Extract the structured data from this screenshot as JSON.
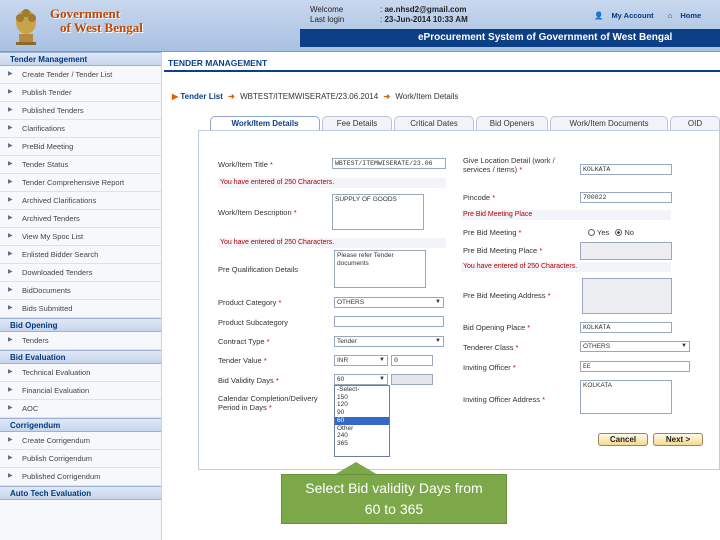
{
  "header": {
    "govt_title_line1": "Government",
    "govt_title_line2": "of West Bengal",
    "welcome_label": "Welcome",
    "welcome_value": "ae.nhsd2@gmail.com",
    "lastlogin_label": "Last login",
    "lastlogin_value": "23-Jun-2014 10:33 AM",
    "my_account": "My Account",
    "home": "Home",
    "system_title": "eProcurement System of Government of West Bengal"
  },
  "sidebar": {
    "sections": [
      {
        "title": "Tender Management",
        "items": [
          "Create Tender / Tender List",
          "Publish Tender",
          "Published Tenders",
          "Clarifications",
          "PreBid Meeting",
          "Tender Status",
          "Tender Comprehensive Report",
          "Archived Clarifications",
          "Archived Tenders",
          "View My Spoc List",
          "Enlisted Bidder Search",
          "Downloaded Tenders",
          "BidDocuments",
          "Bids Submitted"
        ]
      },
      {
        "title": "Bid Opening",
        "items": [
          "Tenders"
        ]
      },
      {
        "title": "Bid Evaluation",
        "items": [
          "Technical Evaluation",
          "Financial Evaluation",
          "AOC"
        ]
      },
      {
        "title": "Corrigendum",
        "items": [
          "Create Corrigendum",
          "Publish Corrigendum",
          "Published Corrigendum"
        ]
      },
      {
        "title": "Auto Tech Evaluation",
        "items": []
      }
    ]
  },
  "main": {
    "section_title": "TENDER MANAGEMENT",
    "breadcrumb": [
      "Tender List",
      "WBTEST/ITEMWISERATE/23.06.2014",
      "Work/Item Details"
    ],
    "tabs": [
      "Work/Item Details",
      "Fee Details",
      "Critical Dates",
      "Bid Openers",
      "Work/Item Documents",
      "OID"
    ]
  },
  "form": {
    "work_title_label": "Work/Item Title",
    "work_title_value": "WBTEST/ITEMWISERATE/23.06",
    "work_title_counter": "You have entered   of 250 Characters.",
    "work_desc_label": "Work/Item Description",
    "work_desc_value": "SUPPLY OF GOODS",
    "work_desc_counter": "You have entered   of 250 Characters.",
    "preq_label": "Pre Qualification Details",
    "preq_value": "Please refer Tender documents",
    "product_category_label": "Product Category",
    "product_category_value": "OTHERS",
    "product_subcategory_label": "Product Subcategory",
    "contract_type_label": "Contract Type",
    "contract_type_value": "Tender",
    "tender_value_label": "Tender Value",
    "tender_currency": "INR",
    "tender_amount": "0",
    "bid_validity_label": "Bid Validity Days",
    "bid_validity_value": "60",
    "completion_label": "Calendar Completion/Delivery Period in Days",
    "bid_validity_options": [
      "-Select-",
      "150",
      "120",
      "90",
      "60",
      "Other",
      "240",
      "365"
    ],
    "bid_validity_selected_index": 4,
    "location_label": "Give Location Detail (work / services / items)",
    "location_value": "KOLKATA",
    "pincode_label": "Pincode",
    "pincode_value": "700022",
    "prebid_place_hint": "Pre Bid Meeting Place",
    "prebid_meeting_label": "Pre Bid Meeting",
    "yes_label": "Yes",
    "no_label": "No",
    "prebid_place_label": "Pre Bid Meeting Place",
    "prebid_place_counter": "You have entered   of 250 Characters.",
    "prebid_address_label": "Pre Bid Meeting Address",
    "bid_opening_place_label": "Bid Opening Place",
    "bid_opening_place_value": "KOLKATA",
    "tenderer_class_label": "Tenderer Class",
    "tenderer_class_value": "OTHERS",
    "inviting_officer_label": "Inviting Officer",
    "inviting_officer_value": "EE",
    "inviting_address_label": "Inviting Officer Address",
    "inviting_address_value": "KOLKATA",
    "cancel_button": "Cancel",
    "next_button": "Next >"
  },
  "callout": {
    "text_line1": "Select Bid validity Days from",
    "text_line2": "60 to 365",
    "color": "#7ca84a"
  }
}
